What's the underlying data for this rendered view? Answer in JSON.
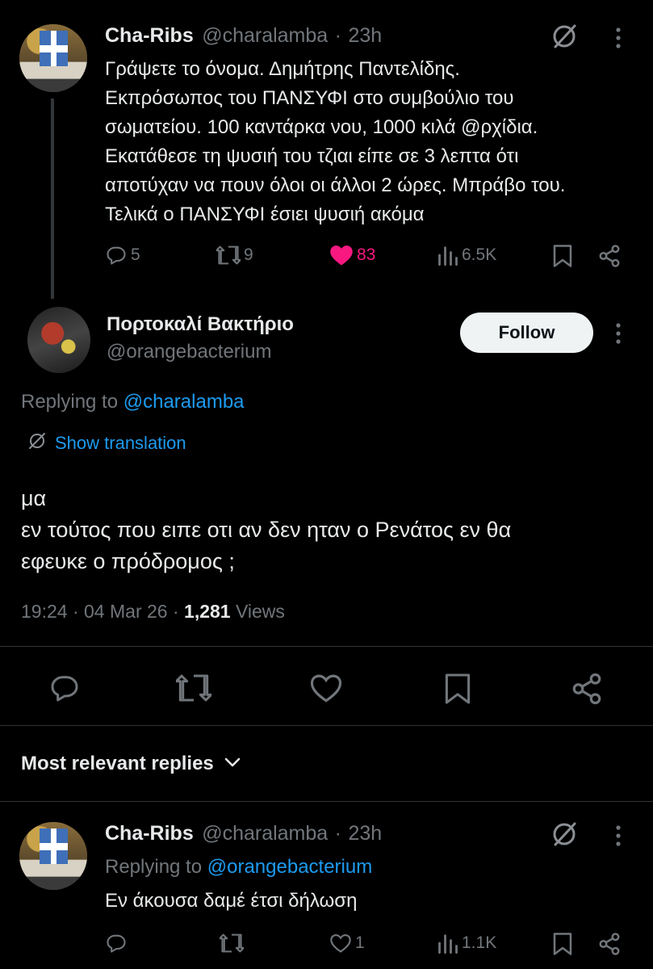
{
  "parent_tweet": {
    "author_name": "Cha-Ribs",
    "author_handle": "@charalamba",
    "separator": "·",
    "time": "23h",
    "text": "Γράψετε το όνομα. Δημήτρης Παντελίδης.\nΕκπρόσωπος του ΠΑΝΣΥΦΙ στο συμβούλιο του\nσωματείου. 100 καντάρκα νου, 1000 κιλά @ρχίδια.\nΕκατάθεσε τη ψυσιή του τζιαι είπε σε 3 λεπτα ότι\nαποτύχαν να πουν όλοι οι άλλοι 2 ώρες. Μπράβο του.\nΤελικά ο ΠΑΝΣΥΦΙ έσιει ψυσιή ακόμα",
    "replies": "5",
    "reposts": "9",
    "likes": "83",
    "views": "6.5K",
    "like_color": "#f91880"
  },
  "main_tweet": {
    "author_name": "Πορτοκαλί Βακτήριο",
    "author_handle": "@orangebacterium",
    "follow_label": "Follow",
    "replying_prefix": "Replying to",
    "replying_to": "@charalamba",
    "translation_label": "Show translation",
    "text": "μα\nεν τούτος που ειπε οτι αν δεν ηταν ο Ρενάτος εν θα\nεφευκε ο πρόδρομος ;",
    "time": "19:24",
    "date": "04 Mar 26",
    "separator": "·",
    "views_count": "1,281",
    "views_label": "Views"
  },
  "replies_section": {
    "sort_label": "Most relevant replies"
  },
  "reply_tweet": {
    "author_name": "Cha-Ribs",
    "author_handle": "@charalamba",
    "separator": "·",
    "time": "23h",
    "replying_prefix": "Replying to",
    "replying_to": "@orangebacterium",
    "text": "Εν άκουσα δαμέ έτσι δήλωση",
    "likes": "1",
    "views": "1.1K"
  },
  "colors": {
    "background": "#000000",
    "text": "#e7e9ea",
    "muted": "#71767b",
    "link": "#1d9bf0",
    "like": "#f91880"
  },
  "icons": [
    "grok-icon",
    "more-icon",
    "reply-icon",
    "repost-icon",
    "like-icon",
    "views-icon",
    "bookmark-icon",
    "share-icon",
    "chevron-down-icon",
    "translate-icon"
  ]
}
